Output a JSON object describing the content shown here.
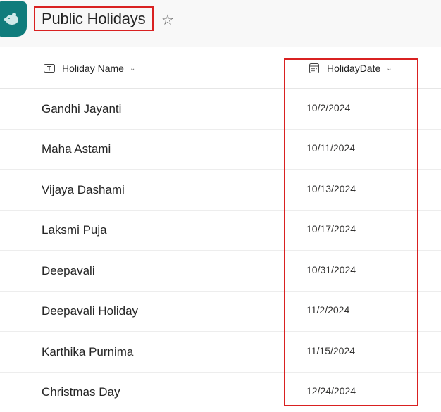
{
  "header": {
    "app_icon": "piggy-bank-icon",
    "title": "Public Holidays",
    "favorite_icon": "star-outline-icon"
  },
  "columns": [
    {
      "label": "Holiday Name",
      "icon": "text-field-icon",
      "menu_icon": "chevron-down-icon"
    },
    {
      "label": "HolidayDate",
      "icon": "calendar-icon",
      "menu_icon": "chevron-down-icon"
    }
  ],
  "rows": [
    {
      "name": "Gandhi Jayanti",
      "date": "10/2/2024"
    },
    {
      "name": "Maha Astami",
      "date": "10/11/2024"
    },
    {
      "name": "Vijaya Dashami",
      "date": "10/13/2024"
    },
    {
      "name": "Laksmi Puja",
      "date": "10/17/2024"
    },
    {
      "name": "Deepavali",
      "date": "10/31/2024"
    },
    {
      "name": "Deepavali Holiday",
      "date": "11/2/2024"
    },
    {
      "name": "Karthika Purnima",
      "date": "11/15/2024"
    },
    {
      "name": "Christmas Day",
      "date": "12/24/2024"
    }
  ],
  "colors": {
    "app_icon_bg": "#107c7c",
    "highlight": "#d92121"
  }
}
